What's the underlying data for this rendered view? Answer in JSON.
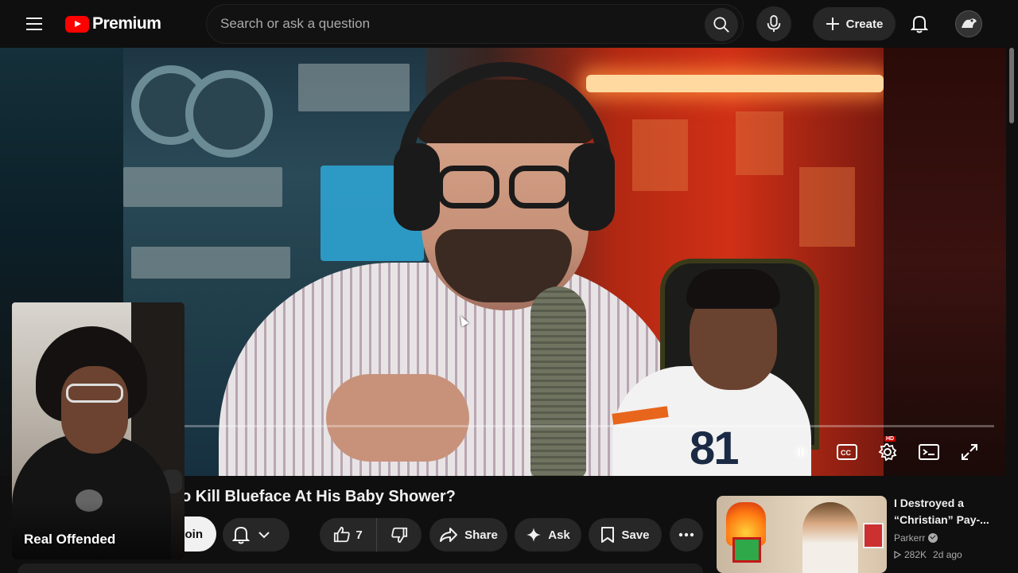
{
  "header": {
    "logo_text": "Premium",
    "search_placeholder": "Search or ask a question",
    "create_label": "Create"
  },
  "icons": {
    "menu": "hamburger-icon",
    "search": "search-icon",
    "mic": "mic-icon",
    "create": "plus-icon",
    "bell": "bell-icon",
    "pause": "pause-icon",
    "captions": "cc-icon",
    "settings": "gear-icon",
    "miniplayer": "miniplayer-icon",
    "fullscreen": "fullscreen-icon"
  },
  "colors": {
    "background": "#0f0f0f",
    "brand_red": "#ff0000",
    "pill": "#272727",
    "text": "#f1f1f1",
    "secondary_text": "#aaaaaa"
  },
  "player": {
    "hd_badge": "HD"
  },
  "webcam": {
    "name": "Real Offended"
  },
  "video": {
    "title": "o Kill Blueface At His Baby Shower?",
    "join_label": "oin",
    "like_count": "7",
    "share_label": "Share",
    "ask_label": "Ask",
    "save_label": "Save"
  },
  "recommendation": {
    "title": "I Destroyed a “Christian” Pay-...",
    "channel": "Parkerr",
    "views": "282K",
    "age": "2d ago"
  }
}
